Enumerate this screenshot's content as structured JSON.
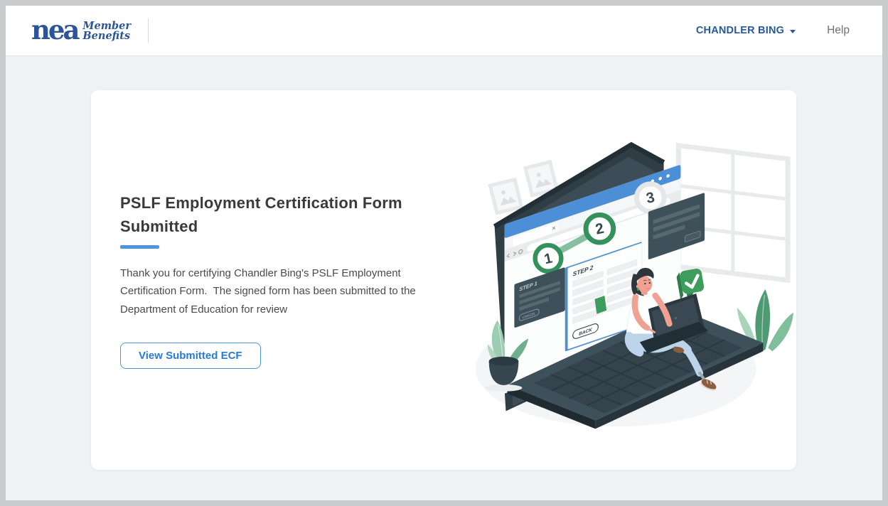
{
  "header": {
    "logo": {
      "mark": "nea",
      "tagline_line1": "Member",
      "tagline_line2": "Benefits"
    },
    "user_menu": {
      "label": "CHANDLER BING",
      "caret_icon": "triangle-down"
    },
    "help_label": "Help"
  },
  "content": {
    "title": "PSLF Employment Certification Form Submitted",
    "body": "Thank you for certifying Chandler Bing's PSLF Employment Certification Form.  The signed form has been submitted to the Department of Education for review",
    "cta_label": "View Submitted ECF"
  },
  "illustration": {
    "description": "person-sitting-on-laptop-completing-multi-step-form",
    "steps": [
      "1",
      "2",
      "3"
    ],
    "step2_form": {
      "title": "STEP 2",
      "back_label": "BACK"
    },
    "step1_panel": {
      "title": "STEP 1",
      "cancel_label": "CANCEL"
    }
  },
  "colors": {
    "brand_blue": "#2B5597",
    "link_blue": "#27599C",
    "accent_blue": "#4B96DD",
    "button_blue": "#2879D8",
    "page_background": "#EFF1F5",
    "frame_gray": "#C9CBCD",
    "step_green": "#35915C",
    "check_green": "#3E9C5C",
    "slate_dark": "#2F3D45"
  }
}
